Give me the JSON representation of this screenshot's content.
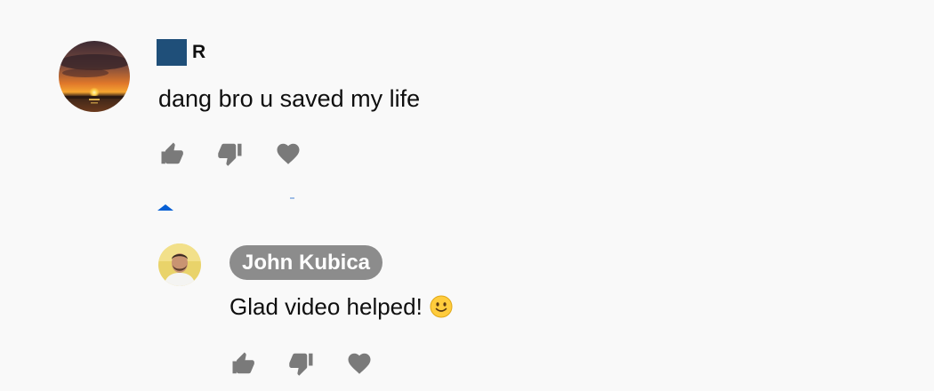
{
  "comment": {
    "author_initial": "R",
    "text": "dang bro u saved my life",
    "actions": [
      {
        "name": "like",
        "icon": "thumbs-up-icon"
      },
      {
        "name": "dislike",
        "icon": "thumbs-down-icon"
      },
      {
        "name": "heart",
        "icon": "heart-icon"
      }
    ]
  },
  "replies_toggle": {
    "icon": "caret-up-icon",
    "color": "#065fd4"
  },
  "reply": {
    "author": "John Kubica",
    "text": "Glad video helped!",
    "emoji": "slightly-smiling-face",
    "actions": [
      {
        "name": "like",
        "icon": "thumbs-up-icon"
      },
      {
        "name": "dislike",
        "icon": "thumbs-down-icon"
      },
      {
        "name": "heart",
        "icon": "heart-icon"
      }
    ]
  },
  "colors": {
    "background": "#f9f9f9",
    "icon_gray": "#7a7a7a",
    "author_chip": "#8c8c8c",
    "redaction": "#1f4f79"
  }
}
